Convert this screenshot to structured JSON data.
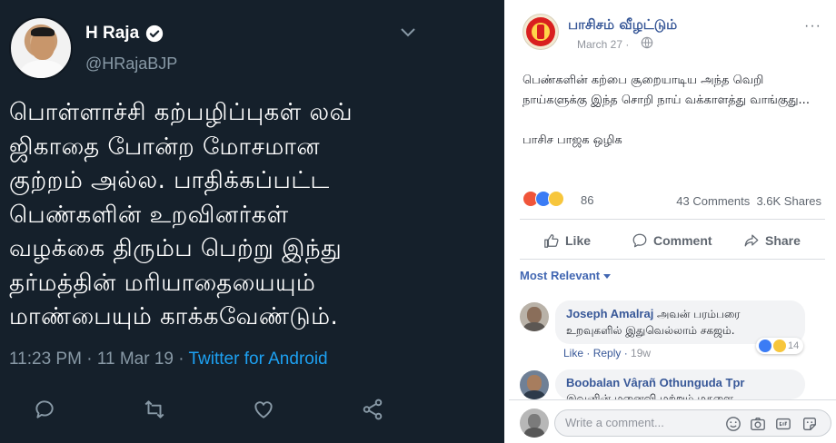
{
  "tweet": {
    "name": "H Raja",
    "handle": "@HRajaBJP",
    "text_lines": [
      "பொள்ளாச்சி கற்பழிப்புகள் லவ்",
      "ஜிகாதை போன்ற மோசமான",
      "குற்றம் அல்ல. பாதிக்கப்பட்ட",
      "பெண்களின் உறவினர்கள்",
      "வழக்கை திரும்ப பெற்று இந்து",
      "தர்மத்தின் மரியாதையையும்",
      "மாண்பையும் காக்கவேண்டும்."
    ],
    "time": "11:23 PM",
    "dot": "·",
    "date": "11 Mar 19",
    "source": "Twitter for Android",
    "colors": {
      "background": "#15202b",
      "secondary": "#8899a6",
      "link": "#1da1f2"
    },
    "icons": [
      "reply-icon",
      "retweet-icon",
      "like-icon",
      "share-icon"
    ]
  },
  "fb_post": {
    "page_name": "பாசிசம் வீழட்டும்",
    "more": "···",
    "date": "March 27 ·",
    "body": [
      "பெண்களின் கற்பை சூறையாடிய அந்த வெறி நாய்களுக்கு இந்த சொறி நாய் வக்காளத்து வாங்குது...",
      "பாசிச பாஜக ஒழிக"
    ],
    "reaction_count": "86",
    "comments_count": "43 Comments",
    "shares_count": "3.6K Shares",
    "actions": {
      "like": "Like",
      "comment": "Comment",
      "share": "Share"
    },
    "sort_label": "Most Relevant",
    "colors": {
      "link": "#385898",
      "secondary": "#606770",
      "bubble": "#f2f3f5"
    }
  },
  "comments": [
    {
      "name": "Joseph Amalraj",
      "text_first": "அவன் பரம்பரை",
      "text_second": "உறவுகளில் இதுவெல்லாம் சகஜம்.",
      "like": "Like",
      "reply": "Reply",
      "time": "19w",
      "reactions": "14"
    },
    {
      "name": "Boobalan Vâŗañ Othunguda Tpr",
      "text_first": "இவனின் மனைவி மற்றும் மகளை"
    }
  ],
  "write_comment": {
    "placeholder": "Write a comment..."
  }
}
